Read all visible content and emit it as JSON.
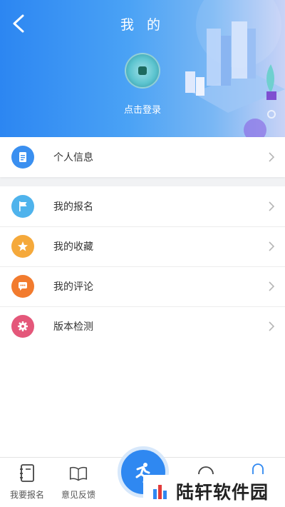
{
  "header": {
    "title": "我 的",
    "login_text": "点击登录",
    "back_icon": "chevron-left-icon"
  },
  "menu_primary": [
    {
      "label": "个人信息",
      "icon": "document-icon",
      "color": "#3a8ff0"
    }
  ],
  "menu_secondary": [
    {
      "label": "我的报名",
      "icon": "flag-icon",
      "color": "#4fb3ec"
    },
    {
      "label": "我的收藏",
      "icon": "star-icon",
      "color": "#f5a93b"
    },
    {
      "label": "我的评论",
      "icon": "chat-bubble-icon",
      "color": "#f27b2e"
    },
    {
      "label": "版本检测",
      "icon": "gear-icon",
      "color": "#e4577a"
    }
  ],
  "tabbar": {
    "items": [
      {
        "label": "我要报名",
        "icon": "notebook-icon"
      },
      {
        "label": "意见反馈",
        "icon": "open-book-icon"
      }
    ],
    "center_icon": "runner-icon"
  },
  "watermark": {
    "text": "陆轩软件园"
  },
  "colors": {
    "accent": "#2f88f1",
    "header_start": "#2c86f2",
    "header_end": "#c9d3f6"
  }
}
